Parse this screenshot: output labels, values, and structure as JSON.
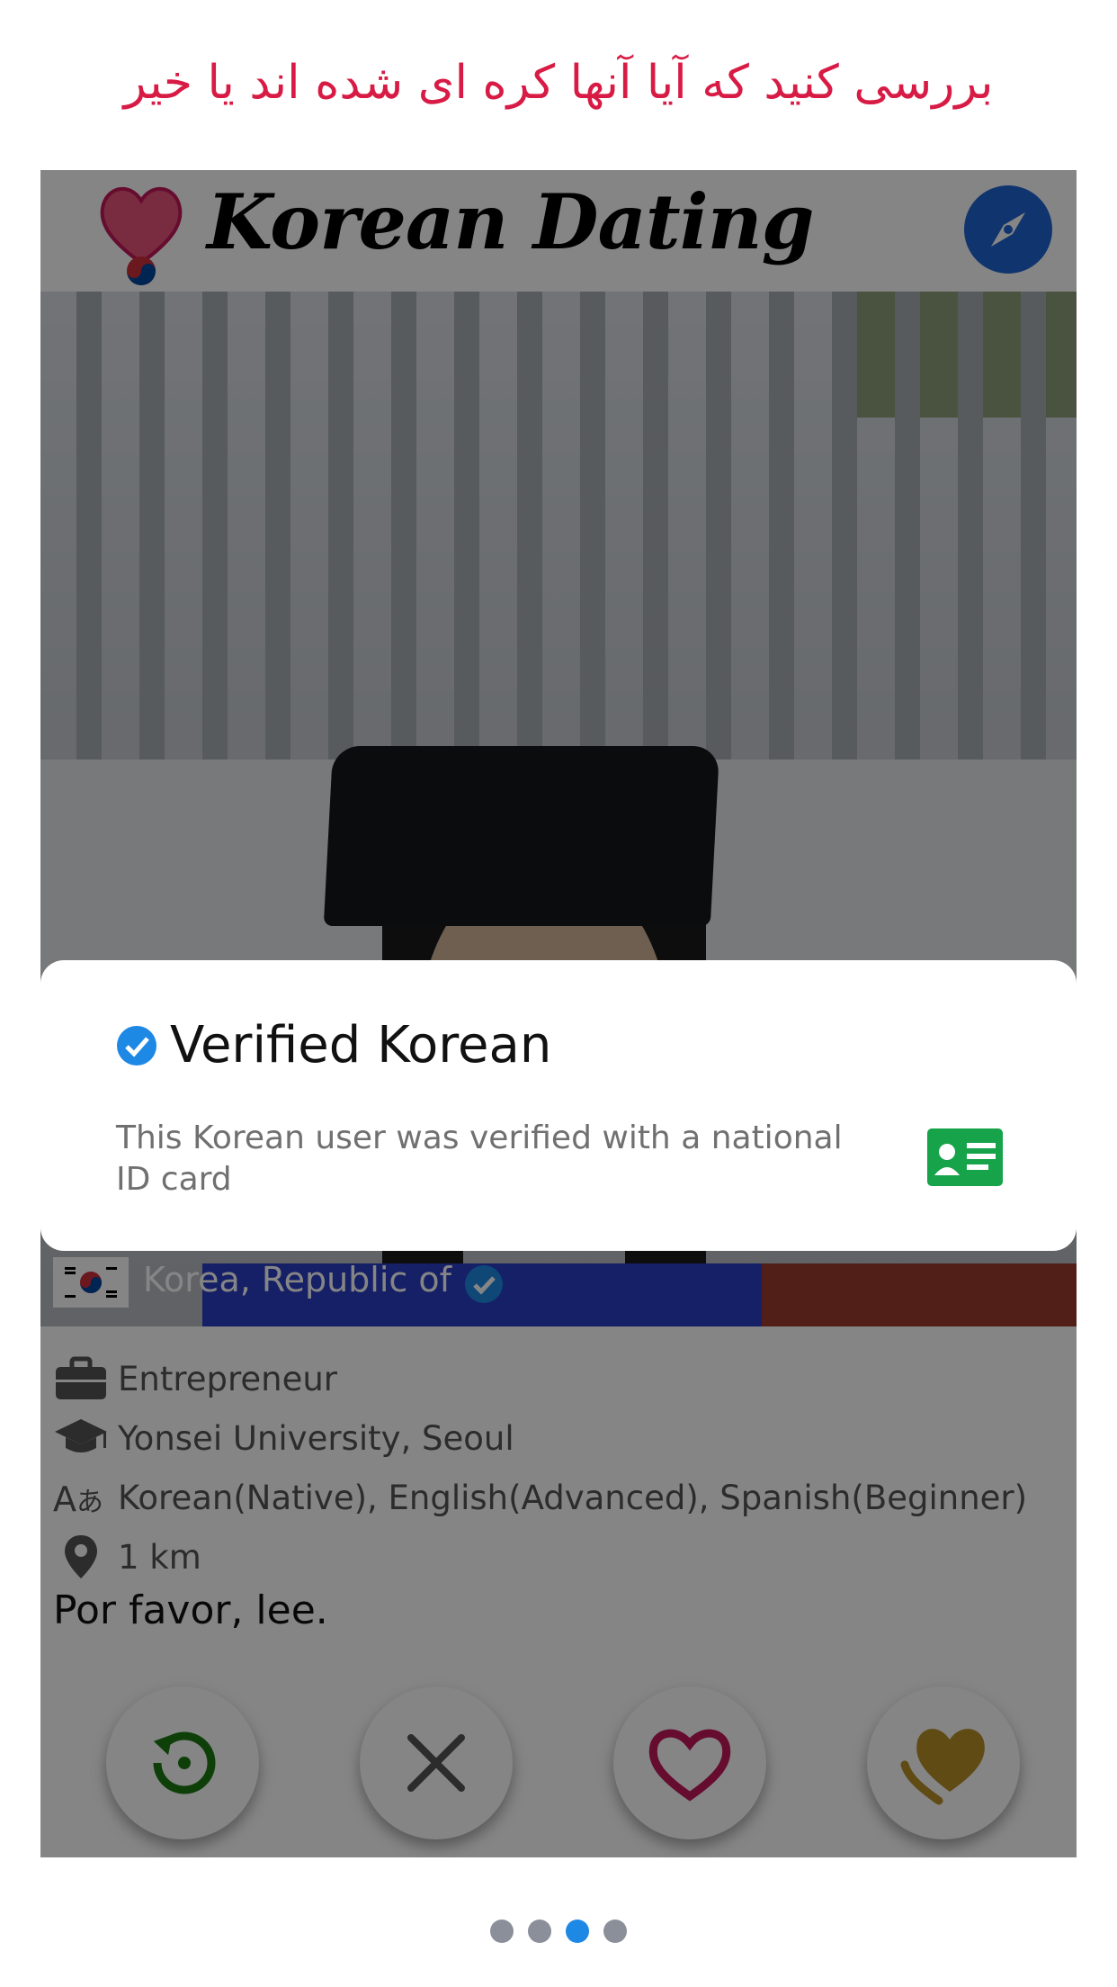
{
  "caption": "بررسی کنید که آیا آنها کره ای شده اند یا خیر",
  "header": {
    "app_title": "Korean Dating",
    "logo_icon": "heart-taegeuk-icon",
    "compass_icon": "compass-icon"
  },
  "profile": {
    "country": "Korea, Republic of",
    "occupation": "Entrepreneur",
    "school": "Yonsei University, Seoul",
    "languages": "Korean(Native), English(Advanced), Spanish(Beginner)",
    "distance": "1 km",
    "bio": "Por favor, lee."
  },
  "actions": {
    "rewind_icon": "rewind-icon",
    "dislike_icon": "close-icon",
    "like_icon": "heart-icon",
    "superlike_icon": "super-heart-icon"
  },
  "dialog": {
    "title": "Verified Korean",
    "description": "This Korean user was verified with a national ID card",
    "badge_icon": "verified-check-icon",
    "card_icon": "id-card-icon"
  },
  "pager": {
    "count": 4,
    "active": 3
  },
  "colors": {
    "caption": "#d81b44",
    "compass": "#1f66d4",
    "verified": "#1e88e5",
    "id_card": "#16a34a",
    "rewind": "#1b7a12",
    "like": "#c2185b",
    "superlike": "#b8902a"
  }
}
